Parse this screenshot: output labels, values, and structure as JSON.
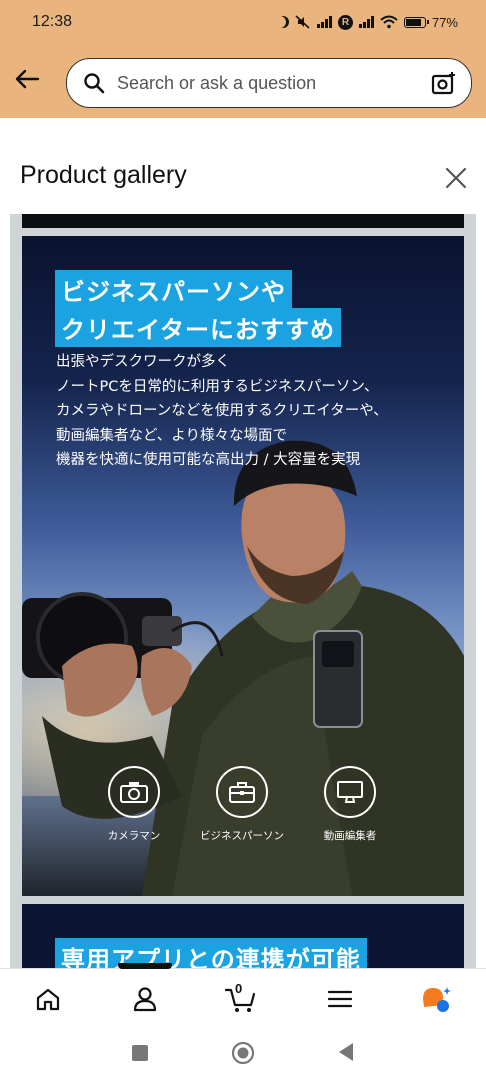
{
  "status_bar": {
    "time": "12:38",
    "battery": "77%"
  },
  "search": {
    "placeholder": "Search or ask a question"
  },
  "gallery": {
    "title": "Product gallery",
    "slide": {
      "headline_1": "ビジネスパーソンや",
      "headline_2": "クリエイターにおすすめ",
      "body_lines": [
        "出張やデスクワークが多く",
        "ノートPCを日常的に利用するビジネスパーソン、",
        "カメラやドローンなどを使用するクリエイターや、",
        "動画編集者など、より様々な場面で",
        "機器を快適に使用可能な高出力 / 大容量を実現"
      ],
      "features": [
        {
          "label": "カメラマン",
          "icon": "camera-icon"
        },
        {
          "label": "ビジネスパーソン",
          "icon": "briefcase-icon"
        },
        {
          "label": "動画編集者",
          "icon": "monitor-icon"
        }
      ]
    },
    "next_slide": {
      "headline": "専用アプリとの連携が可能"
    }
  },
  "bottom_nav": {
    "items": [
      "home-icon",
      "account-icon",
      "cart-icon",
      "menu-icon",
      "assistant-icon"
    ],
    "cart_count": "0"
  },
  "colors": {
    "header": "#e9b47e",
    "accent": "#1aa3e0",
    "assistant": "#f47b20"
  }
}
